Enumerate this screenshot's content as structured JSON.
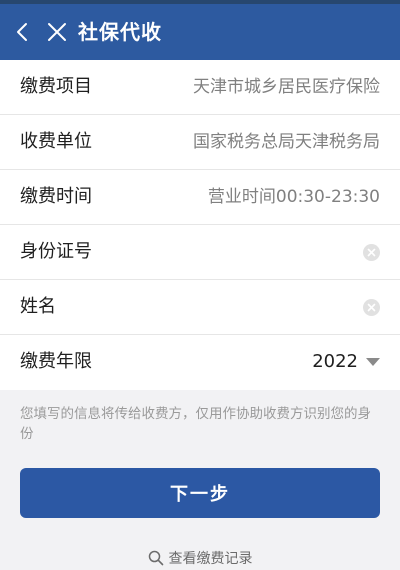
{
  "header": {
    "title": "社保代收",
    "back_icon": "back-arrow-icon",
    "close_icon": "close-icon"
  },
  "form": {
    "rows": [
      {
        "label": "缴费项目",
        "value": "天津市城乡居民医疗保险"
      },
      {
        "label": "收费单位",
        "value": "国家税务总局天津税务局"
      },
      {
        "label": "缴费时间",
        "value": "营业时间00:30-23:30"
      },
      {
        "label": "身份证号",
        "value": "",
        "placeholder": ""
      },
      {
        "label": "姓名",
        "value": "",
        "placeholder": ""
      },
      {
        "label": "缴费年限",
        "value": "2022"
      }
    ]
  },
  "notice": "您填写的信息将传给收费方，仅用作协助收费方识别您的身份",
  "actions": {
    "next_label": "下一步",
    "records_label": "查看缴费记录"
  },
  "colors": {
    "primary": "#2c58a4",
    "header_bg": "#2d5aa0",
    "page_bg": "#f2f2f4"
  }
}
